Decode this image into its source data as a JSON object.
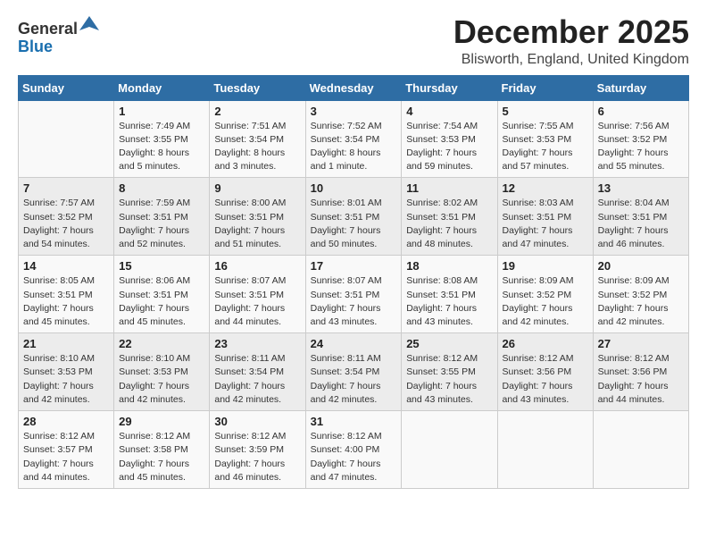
{
  "logo": {
    "general": "General",
    "blue": "Blue"
  },
  "header": {
    "month": "December 2025",
    "location": "Blisworth, England, United Kingdom"
  },
  "weekdays": [
    "Sunday",
    "Monday",
    "Tuesday",
    "Wednesday",
    "Thursday",
    "Friday",
    "Saturday"
  ],
  "weeks": [
    [
      {
        "day": "",
        "info": ""
      },
      {
        "day": "1",
        "info": "Sunrise: 7:49 AM\nSunset: 3:55 PM\nDaylight: 8 hours\nand 5 minutes."
      },
      {
        "day": "2",
        "info": "Sunrise: 7:51 AM\nSunset: 3:54 PM\nDaylight: 8 hours\nand 3 minutes."
      },
      {
        "day": "3",
        "info": "Sunrise: 7:52 AM\nSunset: 3:54 PM\nDaylight: 8 hours\nand 1 minute."
      },
      {
        "day": "4",
        "info": "Sunrise: 7:54 AM\nSunset: 3:53 PM\nDaylight: 7 hours\nand 59 minutes."
      },
      {
        "day": "5",
        "info": "Sunrise: 7:55 AM\nSunset: 3:53 PM\nDaylight: 7 hours\nand 57 minutes."
      },
      {
        "day": "6",
        "info": "Sunrise: 7:56 AM\nSunset: 3:52 PM\nDaylight: 7 hours\nand 55 minutes."
      }
    ],
    [
      {
        "day": "7",
        "info": "Sunrise: 7:57 AM\nSunset: 3:52 PM\nDaylight: 7 hours\nand 54 minutes."
      },
      {
        "day": "8",
        "info": "Sunrise: 7:59 AM\nSunset: 3:51 PM\nDaylight: 7 hours\nand 52 minutes."
      },
      {
        "day": "9",
        "info": "Sunrise: 8:00 AM\nSunset: 3:51 PM\nDaylight: 7 hours\nand 51 minutes."
      },
      {
        "day": "10",
        "info": "Sunrise: 8:01 AM\nSunset: 3:51 PM\nDaylight: 7 hours\nand 50 minutes."
      },
      {
        "day": "11",
        "info": "Sunrise: 8:02 AM\nSunset: 3:51 PM\nDaylight: 7 hours\nand 48 minutes."
      },
      {
        "day": "12",
        "info": "Sunrise: 8:03 AM\nSunset: 3:51 PM\nDaylight: 7 hours\nand 47 minutes."
      },
      {
        "day": "13",
        "info": "Sunrise: 8:04 AM\nSunset: 3:51 PM\nDaylight: 7 hours\nand 46 minutes."
      }
    ],
    [
      {
        "day": "14",
        "info": "Sunrise: 8:05 AM\nSunset: 3:51 PM\nDaylight: 7 hours\nand 45 minutes."
      },
      {
        "day": "15",
        "info": "Sunrise: 8:06 AM\nSunset: 3:51 PM\nDaylight: 7 hours\nand 45 minutes."
      },
      {
        "day": "16",
        "info": "Sunrise: 8:07 AM\nSunset: 3:51 PM\nDaylight: 7 hours\nand 44 minutes."
      },
      {
        "day": "17",
        "info": "Sunrise: 8:07 AM\nSunset: 3:51 PM\nDaylight: 7 hours\nand 43 minutes."
      },
      {
        "day": "18",
        "info": "Sunrise: 8:08 AM\nSunset: 3:51 PM\nDaylight: 7 hours\nand 43 minutes."
      },
      {
        "day": "19",
        "info": "Sunrise: 8:09 AM\nSunset: 3:52 PM\nDaylight: 7 hours\nand 42 minutes."
      },
      {
        "day": "20",
        "info": "Sunrise: 8:09 AM\nSunset: 3:52 PM\nDaylight: 7 hours\nand 42 minutes."
      }
    ],
    [
      {
        "day": "21",
        "info": "Sunrise: 8:10 AM\nSunset: 3:53 PM\nDaylight: 7 hours\nand 42 minutes."
      },
      {
        "day": "22",
        "info": "Sunrise: 8:10 AM\nSunset: 3:53 PM\nDaylight: 7 hours\nand 42 minutes."
      },
      {
        "day": "23",
        "info": "Sunrise: 8:11 AM\nSunset: 3:54 PM\nDaylight: 7 hours\nand 42 minutes."
      },
      {
        "day": "24",
        "info": "Sunrise: 8:11 AM\nSunset: 3:54 PM\nDaylight: 7 hours\nand 42 minutes."
      },
      {
        "day": "25",
        "info": "Sunrise: 8:12 AM\nSunset: 3:55 PM\nDaylight: 7 hours\nand 43 minutes."
      },
      {
        "day": "26",
        "info": "Sunrise: 8:12 AM\nSunset: 3:56 PM\nDaylight: 7 hours\nand 43 minutes."
      },
      {
        "day": "27",
        "info": "Sunrise: 8:12 AM\nSunset: 3:56 PM\nDaylight: 7 hours\nand 44 minutes."
      }
    ],
    [
      {
        "day": "28",
        "info": "Sunrise: 8:12 AM\nSunset: 3:57 PM\nDaylight: 7 hours\nand 44 minutes."
      },
      {
        "day": "29",
        "info": "Sunrise: 8:12 AM\nSunset: 3:58 PM\nDaylight: 7 hours\nand 45 minutes."
      },
      {
        "day": "30",
        "info": "Sunrise: 8:12 AM\nSunset: 3:59 PM\nDaylight: 7 hours\nand 46 minutes."
      },
      {
        "day": "31",
        "info": "Sunrise: 8:12 AM\nSunset: 4:00 PM\nDaylight: 7 hours\nand 47 minutes."
      },
      {
        "day": "",
        "info": ""
      },
      {
        "day": "",
        "info": ""
      },
      {
        "day": "",
        "info": ""
      }
    ]
  ]
}
